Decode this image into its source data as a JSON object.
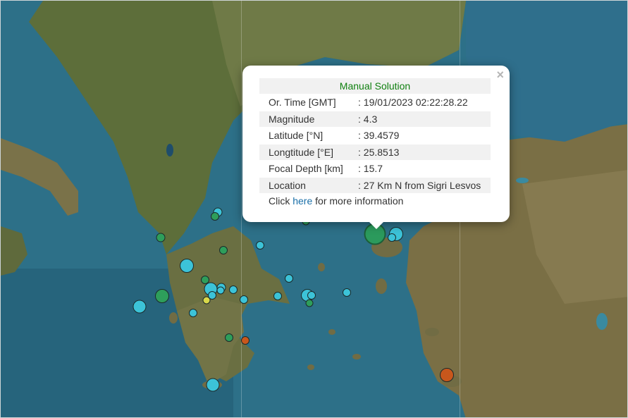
{
  "popup": {
    "title": "Manual Solution",
    "close_glyph": "×",
    "rows": [
      {
        "label": "Or. Time [GMT]",
        "value": ": 19/01/2023 02:22:28.22"
      },
      {
        "label": "Magnitude",
        "value": ": 4.3"
      },
      {
        "label": "Latitude [°N]",
        "value": ": 39.4579"
      },
      {
        "label": "Longtitude [°E]",
        "value": ": 25.8513"
      },
      {
        "label": "Focal Depth [km]",
        "value": ": 15.7"
      },
      {
        "label": "Location",
        "value": ": 27 Km N from Sigri Lesvos"
      }
    ],
    "more_prefix": "Click",
    "more_link": "here",
    "more_suffix": "for more information"
  },
  "marker_colors": {
    "cyan": "#3cc3d8",
    "green": "#2e9e5b",
    "yellow": "#d8d84a",
    "orange": "#c8571c",
    "selected": "#2b9a5c"
  }
}
